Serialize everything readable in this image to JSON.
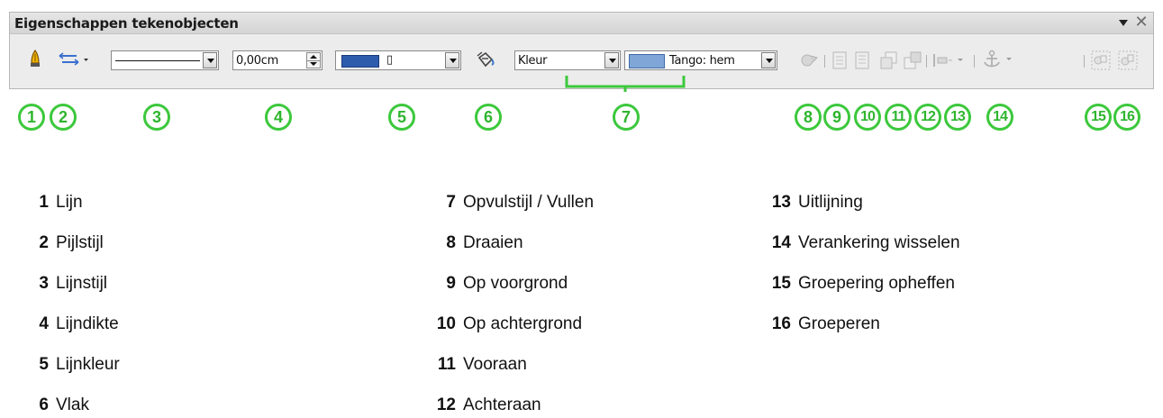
{
  "toolbar": {
    "title": "Eigenschappen tekenobjecten",
    "line_width_value": "0,00cm",
    "line_color_name": "▯",
    "line_color_hex": "#2e5cad",
    "area_style": "Kleur",
    "fill_color_label": "Tango: hem",
    "fill_color_hex": "#7fa6d6"
  },
  "callouts": [
    "1",
    "2",
    "3",
    "4",
    "5",
    "6",
    "7",
    "8",
    "9",
    "10",
    "11",
    "12",
    "13",
    "14",
    "15",
    "16"
  ],
  "legend": [
    {
      "num": "1",
      "label": "Lijn"
    },
    {
      "num": "2",
      "label": "Pijlstijl"
    },
    {
      "num": "3",
      "label": "Lijnstijl"
    },
    {
      "num": "4",
      "label": "Lijndikte"
    },
    {
      "num": "5",
      "label": "Lijnkleur"
    },
    {
      "num": "6",
      "label": "Vlak"
    },
    {
      "num": "7",
      "label": "Opvulstijl / Vullen"
    },
    {
      "num": "8",
      "label": "Draaien"
    },
    {
      "num": "9",
      "label": "Op voorgrond"
    },
    {
      "num": "10",
      "label": "Op achtergrond"
    },
    {
      "num": "11",
      "label": "Vooraan"
    },
    {
      "num": "12",
      "label": "Achteraan"
    },
    {
      "num": "13",
      "label": "Uitlijning"
    },
    {
      "num": "14",
      "label": "Verankering wisselen"
    },
    {
      "num": "15",
      "label": "Groepering opheffen"
    },
    {
      "num": "16",
      "label": "Groeperen"
    }
  ],
  "colors": {
    "callout": "#3cc83c",
    "bracket": "#3cc83c"
  }
}
